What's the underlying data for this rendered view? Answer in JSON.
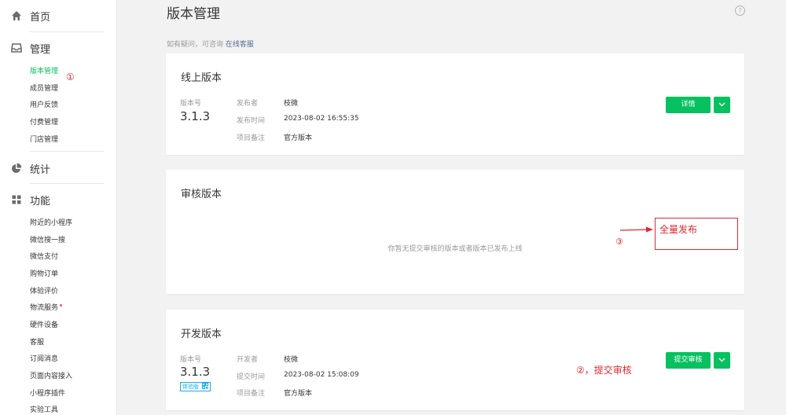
{
  "sidebar": {
    "home": {
      "label": "首页",
      "icon": "home-icon"
    },
    "manage": {
      "label": "管理",
      "icon": "inbox-icon",
      "items": [
        "版本管理",
        "成员管理",
        "用户反馈",
        "付费管理",
        "门店管理"
      ]
    },
    "stats": {
      "label": "统计",
      "icon": "pie-chart-icon"
    },
    "features": {
      "label": "功能",
      "icon": "grid-icon",
      "items": [
        "附近的小程序",
        "微信搜一搜",
        "微信支付",
        "购物订单",
        "体验评价",
        "物流服务",
        "硬件设备",
        "客服",
        "订阅消息",
        "页面内容接入",
        "小程序插件",
        "实验工具"
      ]
    }
  },
  "annotations": {
    "one": "①",
    "two": "②，提交审核",
    "three": "③",
    "box": "全量发布"
  },
  "page": {
    "title": "版本管理",
    "help_prefix": "如有疑问，可咨询",
    "help_link": "在线客服",
    "help_icon": "?"
  },
  "online": {
    "title": "线上版本",
    "version_label": "版本号",
    "version": "3.1.3",
    "fields": [
      {
        "label": "发布者",
        "value": "枝微"
      },
      {
        "label": "发布时间",
        "value": "2023-08-02 16:55:35"
      },
      {
        "label": "项目备注",
        "value": "官方版本"
      }
    ],
    "button": "详情"
  },
  "review": {
    "title": "审核版本",
    "empty": "你暂无提交审核的版本或者版本已发布上线"
  },
  "dev": {
    "title": "开发版本",
    "version_label": "版本号",
    "version": "3.1.3",
    "tag": "体验版",
    "fields": [
      {
        "label": "开发者",
        "value": "枝微"
      },
      {
        "label": "提交时间",
        "value": "2023-08-02 15:08:09"
      },
      {
        "label": "项目备注",
        "value": "官方版本"
      }
    ],
    "button": "提交审核"
  },
  "colors": {
    "accent": "#07c160",
    "annotation": "#e3262e",
    "link": "#576b95"
  }
}
